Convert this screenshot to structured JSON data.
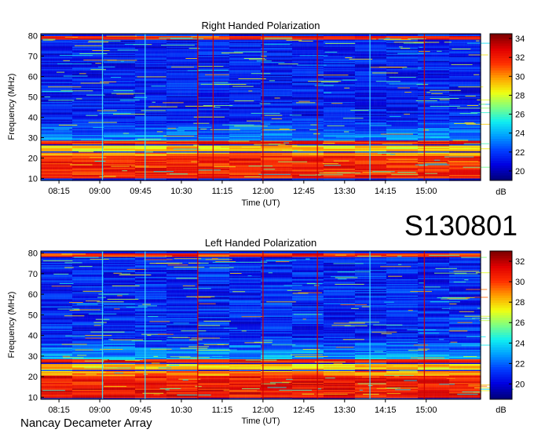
{
  "figure": {
    "code": "S130801",
    "footer": "Nancay Decameter Array"
  },
  "colormap": [
    "#00007f",
    "#0000e0",
    "#0040ff",
    "#00a0ff",
    "#10f0f0",
    "#80ff80",
    "#f0ff10",
    "#ffa000",
    "#ff3000",
    "#e00000",
    "#800000"
  ],
  "chart_data": [
    {
      "type": "heatmap",
      "title": "Right Handed Polarization",
      "xlabel": "Time (UT)",
      "ylabel": "Frequency (MHz)",
      "colorbar_label": "dB",
      "x_ticks": [
        "08:15",
        "09:00",
        "09:45",
        "10:30",
        "11:15",
        "12:00",
        "12:45",
        "13:30",
        "14:15",
        "15:00"
      ],
      "x_tick_minutes": [
        495,
        540,
        585,
        630,
        675,
        720,
        765,
        810,
        855,
        900
      ],
      "xlim": [
        "07:55",
        "16:00"
      ],
      "y_ticks": [
        10,
        20,
        30,
        40,
        50,
        60,
        70,
        80
      ],
      "ylim": [
        9,
        81
      ],
      "colorbar_ticks": [
        20,
        22,
        24,
        26,
        28,
        30,
        32,
        34
      ],
      "zlim": [
        19,
        34.5
      ],
      "strong_bands_mhz": [
        [
          10,
          21,
          32
        ],
        [
          21,
          23,
          30
        ],
        [
          23.5,
          26.5,
          29
        ],
        [
          27,
          28.5,
          32
        ]
      ],
      "vertical_lines": [
        {
          "time": "09:03",
          "kind": "cyan"
        },
        {
          "time": "09:50",
          "kind": "cyan"
        },
        {
          "time": "10:48",
          "kind": "red"
        },
        {
          "time": "11:05",
          "kind": "red"
        },
        {
          "time": "12:00",
          "kind": "red"
        },
        {
          "time": "13:00",
          "kind": "red"
        },
        {
          "time": "13:58",
          "kind": "cyan"
        },
        {
          "time": "14:58",
          "kind": "red"
        }
      ]
    },
    {
      "type": "heatmap",
      "title": "Left Handed Polarization",
      "xlabel": "Time (UT)",
      "ylabel": "Frequency (MHz)",
      "colorbar_label": "dB",
      "x_ticks": [
        "08:15",
        "09:00",
        "09:45",
        "10:30",
        "11:15",
        "12:00",
        "12:45",
        "13:30",
        "14:15",
        "15:00"
      ],
      "x_tick_minutes": [
        495,
        540,
        585,
        630,
        675,
        720,
        765,
        810,
        855,
        900
      ],
      "xlim": [
        "07:55",
        "16:00"
      ],
      "y_ticks": [
        10,
        20,
        30,
        40,
        50,
        60,
        70,
        80
      ],
      "ylim": [
        9,
        81
      ],
      "colorbar_ticks": [
        20,
        22,
        24,
        26,
        28,
        30,
        32
      ],
      "zlim": [
        18.5,
        33
      ],
      "strong_bands_mhz": [
        [
          10,
          20.5,
          31
        ],
        [
          21,
          23,
          29
        ],
        [
          23.5,
          26.5,
          28
        ],
        [
          27,
          28.5,
          31
        ]
      ],
      "vertical_lines": [
        {
          "time": "09:03",
          "kind": "cyan"
        },
        {
          "time": "09:50",
          "kind": "cyan"
        },
        {
          "time": "10:48",
          "kind": "red"
        },
        {
          "time": "12:00",
          "kind": "red"
        },
        {
          "time": "13:00",
          "kind": "red"
        },
        {
          "time": "13:58",
          "kind": "cyan"
        },
        {
          "time": "14:58",
          "kind": "red"
        }
      ]
    }
  ]
}
